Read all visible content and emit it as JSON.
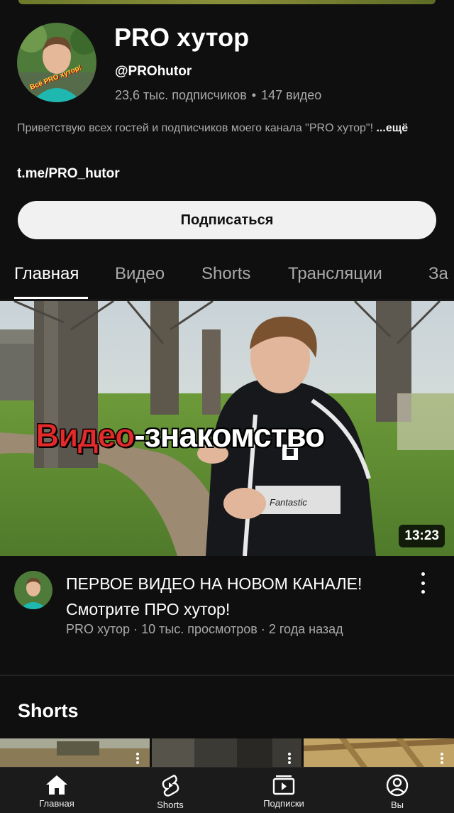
{
  "channel": {
    "name": "PRO хутор",
    "handle": "@PROhutor",
    "subscribers": "23,6 тыс. подписчиков",
    "videos_count": "147 видео",
    "stats_separator": "•",
    "avatar_caption": "Всё PRO хутор!",
    "description": "Приветствую всех гостей и подписчиков моего канала \"PRO хутор\"!",
    "more_label": "...ещё",
    "link": "t.me/PRO_hutor"
  },
  "subscribe_label": "Подписаться",
  "tabs": [
    {
      "label": "Главная",
      "active": true
    },
    {
      "label": "Видео",
      "active": false
    },
    {
      "label": "Shorts",
      "active": false
    },
    {
      "label": "Трансляции",
      "active": false
    },
    {
      "label": "За",
      "active": false
    }
  ],
  "featured_video": {
    "overlay_red": "Видео",
    "overlay_white": "-знакомство",
    "shirt_text": "Fantastic",
    "duration": "13:23",
    "title": "ПЕРВОЕ ВИДЕО НА НОВОМ КАНАЛЕ! Смотрите ПРО хутор!",
    "meta": "PRO хутор · 10 тыс. просмотров · 2 года назад"
  },
  "shorts_section": {
    "heading": "Shorts"
  },
  "bottom_nav": [
    {
      "label": "Главная",
      "icon": "home-icon"
    },
    {
      "label": "Shorts",
      "icon": "shorts-icon"
    },
    {
      "label": "Подписки",
      "icon": "subscriptions-icon"
    },
    {
      "label": "Вы",
      "icon": "profile-icon"
    }
  ],
  "colors": {
    "background": "#0f0f0f",
    "subscribe_button": "#f1f1f1",
    "secondary_text": "#aaaaaa",
    "overlay_red": "#e32b2b"
  }
}
